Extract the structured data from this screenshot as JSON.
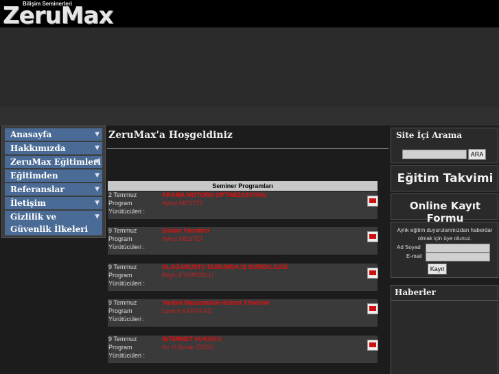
{
  "logo": {
    "small": "Bilişim Seminerleri",
    "big": "ZeruMax"
  },
  "nav": {
    "items": [
      {
        "label": "Anasayfa"
      },
      {
        "label": "Hakkımızda"
      },
      {
        "label": "ZeruMax Eğitimleri"
      },
      {
        "label": "Eğitimden Görüntüler"
      },
      {
        "label": "Referanslar"
      },
      {
        "label": "İletişim"
      },
      {
        "label": "Gizlilik ve Güvenlik İlkeleri"
      }
    ]
  },
  "main": {
    "title": "ZeruMax'a Hoşgeldiniz",
    "seminar_header": "Seminer Programları",
    "program_label": "Program",
    "yurutucu_label": "Yürütücüleri :",
    "seminars": [
      {
        "date": "2 Temmuz",
        "title": "ARAMA MOTORU OPTİMİZASYONU",
        "speaker": "Aykut MESTCİ"
      },
      {
        "date": "9 Temmuz",
        "title": "Sürüm Yönetimi",
        "speaker": "Aykut MESTCİ"
      },
      {
        "date": "9 Temmuz",
        "title": "OLAĞANÜSTÜ DURUMDA İŞ SÜREKLİLİĞİ",
        "speaker": "Bilgin EYÜPOĞLU"
      },
      {
        "date": "9 Temmuz",
        "title": "Yardım Masasından Hizmet Yönetimi",
        "speaker": "Levent KARAKAŞ"
      },
      {
        "date": "9 Temmuz",
        "title": "İNTERNET HUKUKU",
        "speaker": "Av. H.Burak ÖZGÜ"
      }
    ]
  },
  "right": {
    "search_title": "Site İçi Arama",
    "search_button": "ARA",
    "calendar": "Eğitim Takvimi",
    "register": "Online Kayıt Formu",
    "newsletter_text": "Aylık eğitim duyurularımızdan haberdar olmak için üye olunuz.",
    "name_label": "Ad Soyad",
    "email_label": "E-mail",
    "submit_label": "Kayıt",
    "news_title": "Haberler"
  },
  "colors": {
    "nav_bg": "#4a6b95",
    "accent_red": "#e01010"
  }
}
